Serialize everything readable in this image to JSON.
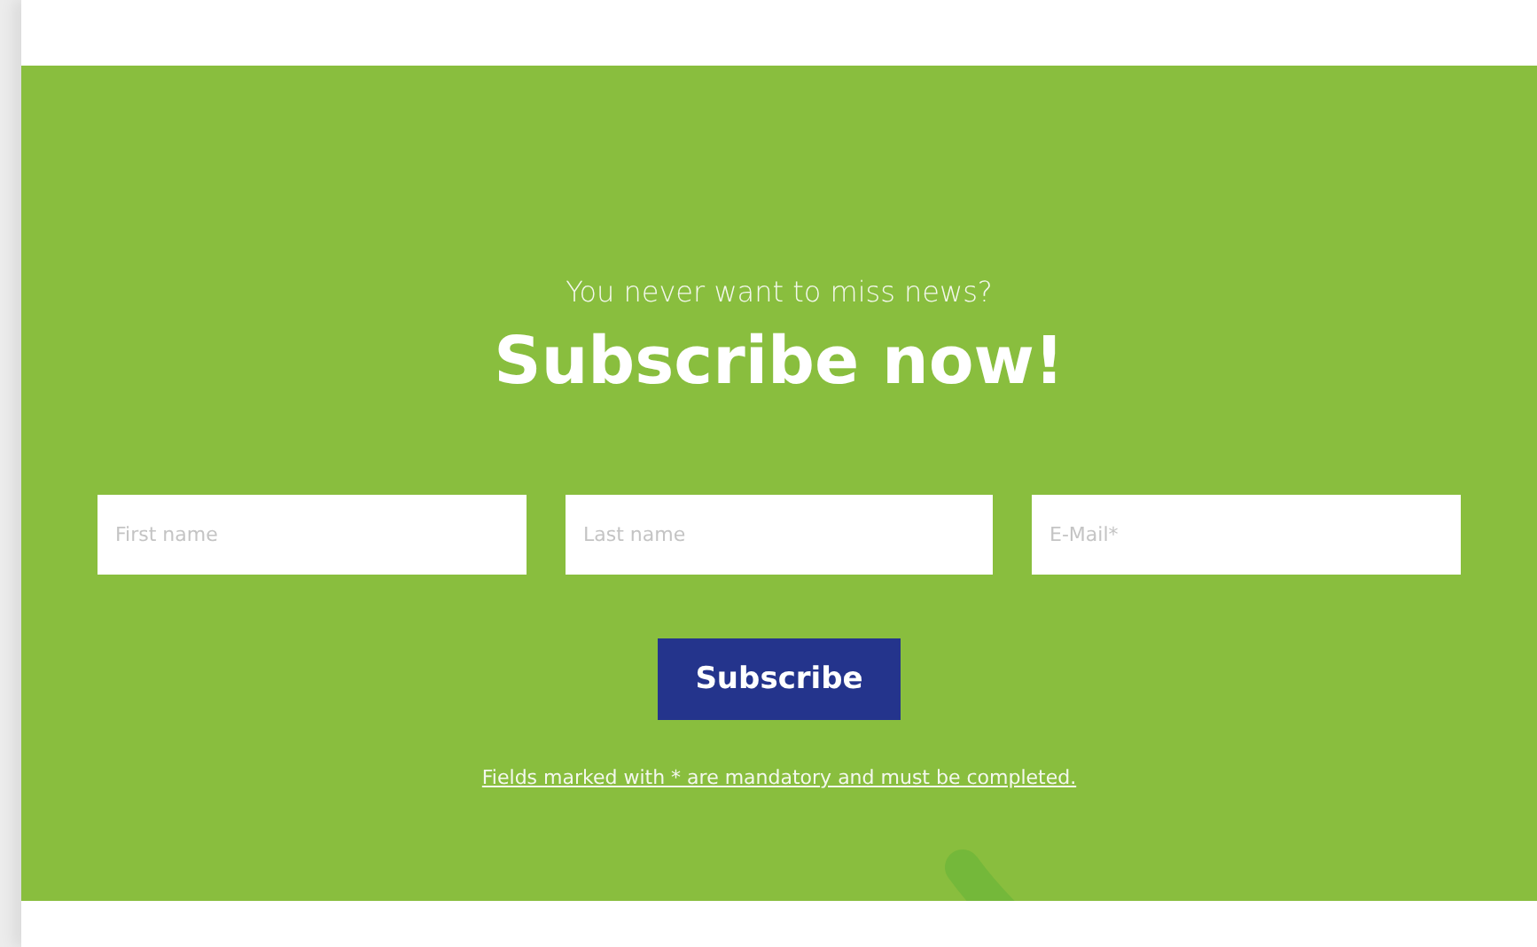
{
  "newsletter": {
    "kicker": "You never want to miss news?",
    "heading": "Subscribe now!",
    "fields": [
      {
        "placeholder": "First name"
      },
      {
        "placeholder": "Last name"
      },
      {
        "placeholder": "E-Mail*"
      }
    ],
    "button": "Subscribe",
    "note": "Fields marked with * are mandatory and must be completed."
  }
}
